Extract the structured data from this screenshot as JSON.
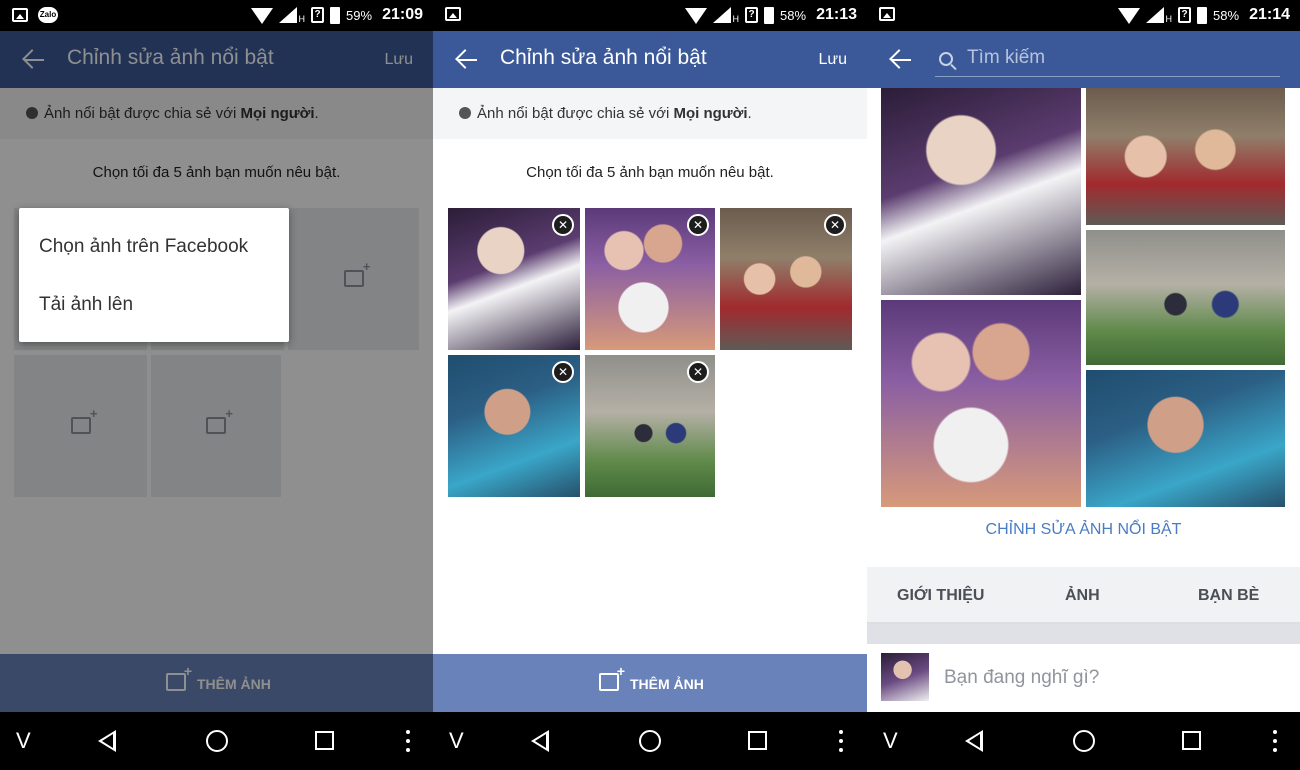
{
  "screens": [
    {
      "status": {
        "battery": "59%",
        "time": "21:09"
      },
      "appbar": {
        "title": "Chỉnh sửa ảnh nổi bật",
        "save": "Lưu"
      },
      "share": {
        "prefix": "Ảnh nổi bật được chia sẻ với ",
        "audience": "Mọi người",
        "suffix": "."
      },
      "prompt": "Chọn tối đa 5 ảnh bạn muốn nêu bật.",
      "menu": {
        "option_facebook": "Chọn ảnh trên Facebook",
        "option_upload": "Tải ảnh lên"
      },
      "bottom": {
        "add_photo": "THÊM ẢNH"
      }
    },
    {
      "status": {
        "battery": "58%",
        "time": "21:13"
      },
      "appbar": {
        "title": "Chỉnh sửa ảnh nổi bật",
        "save": "Lưu"
      },
      "share": {
        "prefix": "Ảnh nổi bật được chia sẻ với ",
        "audience": "Mọi người",
        "suffix": "."
      },
      "prompt": "Chọn tối đa 5 ảnh bạn muốn nêu bật.",
      "bottom": {
        "add_photo": "THÊM ẢNH"
      },
      "remove_glyph": "✕"
    },
    {
      "status": {
        "battery": "58%",
        "time": "21:14"
      },
      "search": {
        "placeholder": "Tìm kiếm"
      },
      "edit_featured": "CHỈNH SỬA ẢNH NỔI BẬT",
      "tabs": [
        "GIỚI THIỆU",
        "ẢNH",
        "BẠN BÈ"
      ],
      "composer": {
        "prompt": "Bạn đang nghĩ gì?"
      }
    }
  ],
  "statusbar_common": {
    "network": "H",
    "zalo": "Zalo"
  },
  "navbar": {
    "v_glyph": "V"
  },
  "colors": {
    "facebook_blue": "#3b5998",
    "bottom_blue": "#6982b9",
    "link_blue": "#4a7cc4"
  }
}
